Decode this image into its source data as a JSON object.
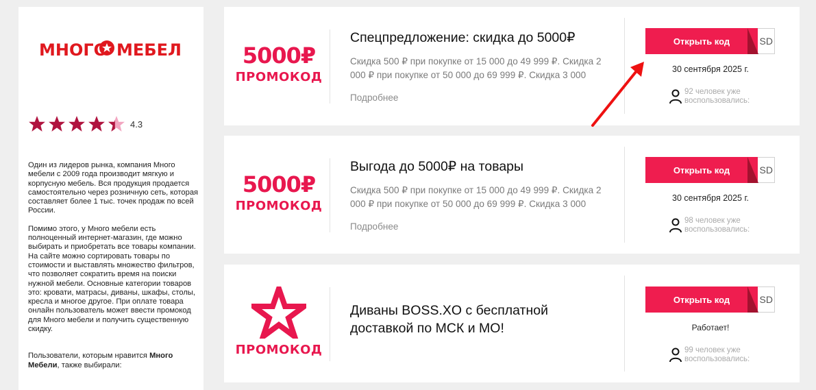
{
  "sidebar": {
    "logo_text": "МНОГО МЕБЕЛИ",
    "rating": "4.3",
    "rating_stars": 4.3,
    "desc_p1": "Один из лидеров рынка, компания Много мебели с 2009 года производит мягкую и корпусную мебель. Вся продукция продается самостоятельно через розничную сеть, которая составляет более 1 тыс. точек продаж по всей России.",
    "desc_p2": "Помимо этого, у Много мебели есть полноценный интернет-магазин, где можно выбирать и приобретать все товары компании. На сайте можно сортировать товары по стоимости и выставлять множество фильтров, что позволяет сократить время на поиски нужной мебели. Основные категории товаров это: кровати, матрасы, диваны, шкафы, столы, кресла и многое другое. При оплате товара онлайн пользователь может ввести промокод для Много мебели и получить существенную скидку.",
    "desc_p3_prefix": "Пользователи, которым нравится ",
    "desc_p3_bold": "Много Мебели",
    "desc_p3_suffix": ", также выбирали:"
  },
  "colors": {
    "accent": "#ef1d4f",
    "brand_red": "#e0181e",
    "star_dark": "#b0133f",
    "star_light": "#f2a5c0"
  },
  "cards": [
    {
      "badge_amount": "5000₽",
      "badge_label": "ПРОМОКОД",
      "title": "Спецпредложение: скидка до 5000₽",
      "text": "Скидка 500 ₽ при покупке от 15 000 до 49 999 ₽. Скидка 2 000 ₽ при покупке от 50 000 до 69 999 ₽. Скидка 3 000",
      "more": "Подробнее",
      "button": "Открыть код",
      "code_tail": "SD",
      "date": "30 сентября 2025 г.",
      "users": "92 человек уже воспользовались:"
    },
    {
      "badge_amount": "5000₽",
      "badge_label": "ПРОМОКОД",
      "title": "Выгода до 5000₽ на товары",
      "text": "Скидка 500 ₽ при покупке от 15 000 до 49 999 ₽. Скидка 2 000 ₽ при покупке от 50 000 до 69 999 ₽. Скидка 3 000",
      "more": "Подробнее",
      "button": "Открыть код",
      "code_tail": "SD",
      "date": "30 сентября 2025 г.",
      "users": "98 человек уже воспользовались:"
    },
    {
      "badge_label": "ПРОМОКОД",
      "badge_icon": "star-outline-icon",
      "title_line1": "Диваны BOSS.XO с бесплатной",
      "title_line2": "доставкой по МСК и МО!",
      "button": "Открыть код",
      "code_tail": "SD",
      "date": "Работает!",
      "users": "99 человек уже воспользовались:"
    }
  ]
}
